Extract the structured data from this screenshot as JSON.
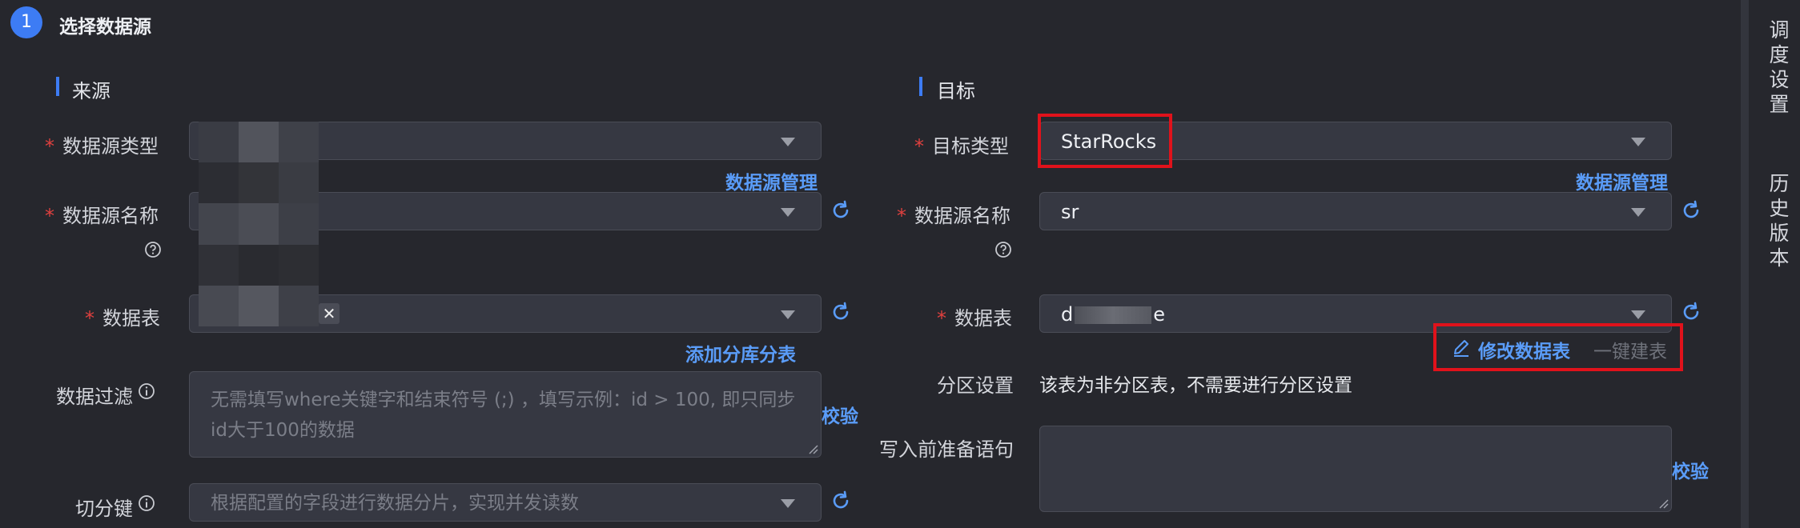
{
  "step": {
    "number": "1",
    "title": "选择数据源"
  },
  "source": {
    "section_title": "来源",
    "datasource_type_label": "数据源类型",
    "datasource_manage_link": "数据源管理",
    "datasource_name_label": "数据源名称",
    "table_label": "数据表",
    "add_shard_link": "添加分库分表",
    "filter_label": "数据过滤",
    "filter_placeholder": "无需填写where关键字和结束符号 (;) ，填写示例：id > 100, 即只同步id大于100的数据",
    "validate_link": "校验",
    "split_key_label": "切分键",
    "split_key_placeholder": "根据配置的字段进行数据分片，实现并发读数"
  },
  "target": {
    "section_title": "目标",
    "type_label": "目标类型",
    "type_value": "StarRocks",
    "datasource_manage_link": "数据源管理",
    "datasource_name_label": "数据源名称",
    "datasource_name_value": "sr",
    "table_label": "数据表",
    "table_value_prefix": "d",
    "table_value_suffix": "e",
    "edit_table_link": "修改数据表",
    "one_click_create": "一键建表",
    "partition_label": "分区设置",
    "partition_text": "该表为非分区表，不需要进行分区设置",
    "pre_sql_label": "写入前准备语句",
    "validate_link": "校验"
  },
  "side": {
    "schedule_settings": "调度设置",
    "history_versions": "历史版本"
  },
  "colors": {
    "accent": "#3d7cf4",
    "link": "#5a9cf8",
    "required": "#e0403f",
    "highlight": "#e0121b"
  }
}
